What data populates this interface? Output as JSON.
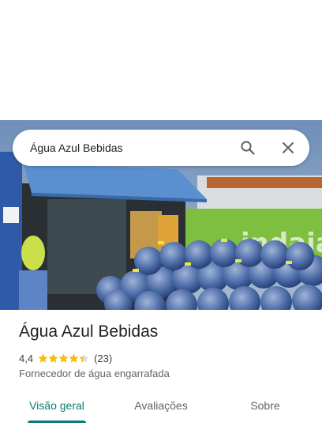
{
  "search": {
    "value": "Água Azul Bebidas",
    "search_icon": "search-icon",
    "close_icon": "close-icon"
  },
  "place": {
    "title": "Água Azul Bebidas",
    "rating": "4,4",
    "rating_stars": 4.4,
    "reviews": "(23)",
    "category": "Fornecedor de água engarrafada"
  },
  "photo": {
    "storefront_text": "indaia"
  },
  "tabs": [
    {
      "label": "Visão geral",
      "active": true
    },
    {
      "label": "Avaliações",
      "active": false
    },
    {
      "label": "Sobre",
      "active": false
    }
  ],
  "colors": {
    "accent": "#0b7a75",
    "star": "#fbbc04"
  }
}
